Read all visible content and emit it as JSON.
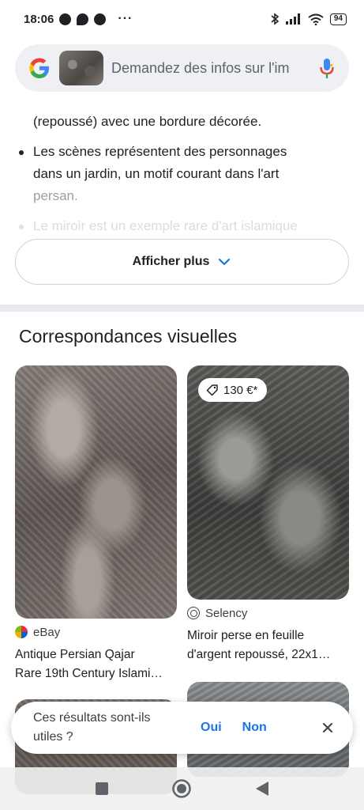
{
  "status_bar": {
    "time": "18:06",
    "battery": "94",
    "more": "···"
  },
  "search": {
    "placeholder": "Demandez des infos sur l'im"
  },
  "summary": {
    "partial_line": "(repoussé) avec une bordure décorée.",
    "bullet2_line1": "Les scènes représentent des personnages",
    "bullet2_line2": "dans un jardin, un motif courant dans l'art",
    "bullet2_line3": "persan.",
    "bullet3_line1": "Le miroir est un exemple rare d'art islamique"
  },
  "show_more": {
    "label": "Afficher plus"
  },
  "visual_matches": {
    "title": "Correspondances visuelles",
    "cards": [
      {
        "source": "eBay",
        "title_line1": "Antique Persian Qajar",
        "title_line2": "Rare 19th Century Islami…"
      },
      {
        "price": "130 €*",
        "source": "Selency",
        "title_line1": "Miroir perse en feuille",
        "title_line2": "d'argent repoussé, 22x1…"
      }
    ]
  },
  "feedback": {
    "question": "Ces résultats sont-ils utiles ?",
    "yes": "Oui",
    "no": "Non"
  },
  "colors": {
    "accent": "#1a73e8",
    "text": "#202124"
  }
}
